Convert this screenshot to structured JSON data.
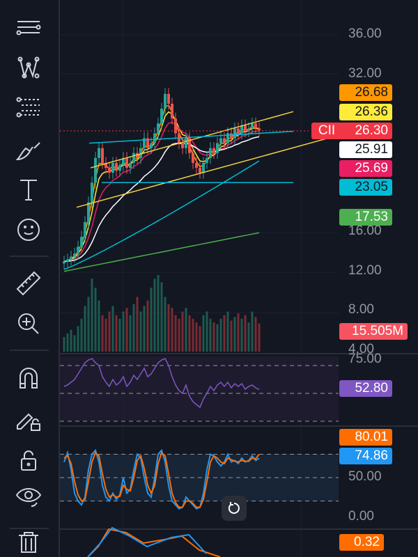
{
  "toolbar": {
    "items": [
      "lines-tool",
      "pattern-tool",
      "fib-tool",
      "brush-tool",
      "text-tool",
      "emoji-tool",
      "ruler-tool",
      "zoom-tool",
      "magnet-tool",
      "lock-drawing-tool",
      "lock-tool",
      "visibility-tool",
      "trash-tool"
    ],
    "text_icon": "T"
  },
  "symbol": "CII",
  "chart_data": {
    "type": "candlestick",
    "price_axis": {
      "ticks": [
        "36.00",
        "32.00",
        "16.00",
        "12.00",
        "8.00",
        "4.00"
      ],
      "tick_values": [
        36,
        32,
        16,
        12,
        8,
        4
      ],
      "ylim": [
        4,
        36
      ]
    },
    "closes": [
      13,
      13.2,
      13.5,
      13.8,
      14.5,
      15.5,
      17,
      19,
      21,
      23.5,
      24.5,
      23,
      22.5,
      22,
      23,
      22.2,
      22.8,
      23.5,
      22.5,
      23,
      24,
      23.5,
      24.5,
      25.5,
      24.5,
      25,
      26,
      27,
      28.5,
      30,
      29,
      27.5,
      26,
      25,
      24.5,
      25.5,
      24,
      23,
      22.5,
      22,
      23,
      23.5,
      24.5,
      24,
      25,
      25.5,
      25,
      26,
      25.5,
      26.5,
      26,
      26.8,
      26.2,
      26.5,
      27,
      26.5,
      26.3
    ],
    "volumes": [
      8,
      10,
      12,
      9,
      14,
      18,
      25,
      30,
      40,
      35,
      28,
      20,
      18,
      22,
      25,
      20,
      18,
      22,
      24,
      20,
      26,
      30,
      22,
      25,
      28,
      35,
      40,
      42,
      38,
      30,
      26,
      24,
      20,
      18,
      22,
      24,
      20,
      18,
      16,
      14,
      20,
      22,
      18,
      16,
      15,
      18,
      20,
      22,
      17,
      19,
      21,
      18,
      20,
      16,
      22,
      19,
      15.5
    ],
    "rsi": [
      55,
      56,
      58,
      60,
      64,
      68,
      72,
      74,
      75,
      72,
      70,
      62,
      58,
      55,
      60,
      56,
      58,
      62,
      55,
      58,
      63,
      60,
      64,
      68,
      62,
      64,
      68,
      72,
      74,
      75,
      70,
      62,
      56,
      52,
      50,
      56,
      48,
      44,
      42,
      40,
      46,
      50,
      55,
      52,
      56,
      58,
      55,
      58,
      54,
      57,
      55,
      57,
      53,
      55,
      56,
      54,
      52.8
    ],
    "stoch_k": [
      70,
      82,
      60,
      30,
      20,
      15,
      25,
      60,
      80,
      85,
      70,
      40,
      25,
      20,
      30,
      22,
      28,
      50,
      30,
      35,
      60,
      80,
      75,
      50,
      30,
      25,
      50,
      80,
      85,
      70,
      40,
      20,
      15,
      10,
      12,
      25,
      20,
      15,
      10,
      12,
      30,
      60,
      80,
      78,
      70,
      65,
      70,
      80,
      70,
      72,
      68,
      75,
      70,
      72,
      78,
      72,
      74.86
    ],
    "stoch_d": [
      75,
      78,
      68,
      45,
      28,
      20,
      22,
      45,
      70,
      82,
      78,
      55,
      35,
      25,
      28,
      25,
      26,
      40,
      35,
      33,
      50,
      72,
      78,
      62,
      40,
      30,
      40,
      68,
      82,
      78,
      55,
      30,
      18,
      12,
      12,
      20,
      20,
      17,
      12,
      12,
      22,
      45,
      70,
      78,
      75,
      70,
      68,
      75,
      73,
      71,
      70,
      72,
      71,
      71,
      75,
      74,
      80.01
    ],
    "ma_lines": [
      {
        "name": "ema-fast",
        "period": 3,
        "color": "#ff9800"
      },
      {
        "name": "ema-mid",
        "period": 5,
        "color": "#ffeb3b"
      },
      {
        "name": "ema-slow",
        "period": 9,
        "color": "#e91e63"
      },
      {
        "name": "sma-20",
        "period": 20,
        "color": "#ffffff"
      }
    ],
    "rsi_levels": [
      70,
      50,
      30
    ],
    "stoch_levels": [
      80,
      50,
      20
    ],
    "rsi_axis": "75.00",
    "stoch_axis": [
      "50.00",
      "0.00"
    ]
  },
  "price_tags": [
    {
      "value": "26.68",
      "bg": "#ff9800",
      "fg": "#131722"
    },
    {
      "value": "26.36",
      "bg": "#ffeb3b",
      "fg": "#131722"
    },
    {
      "value": "26.30",
      "bg": "#f23645",
      "fg": "#ffffff"
    },
    {
      "value": "25.91",
      "bg": "#ffffff",
      "fg": "#131722"
    },
    {
      "value": "25.69",
      "bg": "#e91e63",
      "fg": "#ffffff"
    },
    {
      "value": "23.05",
      "bg": "#00bcd4",
      "fg": "#131722"
    },
    {
      "value": "17.53",
      "bg": "#4caf50",
      "fg": "#ffffff"
    }
  ],
  "volume_tag": {
    "value": "15.505M",
    "bg": "#f7525f"
  },
  "rsi_tag": {
    "value": "52.80",
    "bg": "#7e57c2"
  },
  "stoch_tags": [
    {
      "value": "80.01",
      "bg": "#ff6d00"
    },
    {
      "value": "74.86",
      "bg": "#2196f3"
    }
  ],
  "macd_tag": {
    "value": "0.32",
    "bg": "#ff6d00"
  }
}
